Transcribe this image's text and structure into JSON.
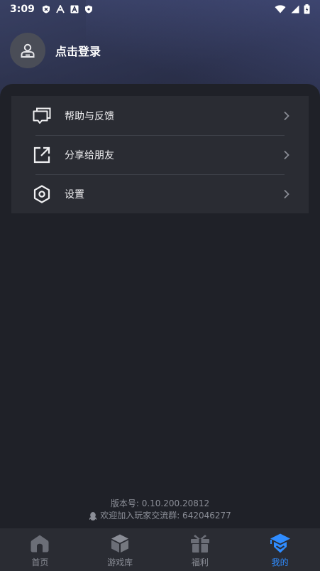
{
  "status_bar": {
    "time": "3:09"
  },
  "profile": {
    "login_text": "点击登录"
  },
  "menu": {
    "items": [
      {
        "label": "帮助与反馈",
        "icon": "feedback-icon"
      },
      {
        "label": "分享给朋友",
        "icon": "share-icon"
      },
      {
        "label": "设置",
        "icon": "settings-icon"
      }
    ]
  },
  "footer": {
    "version": "版本号: 0.10.200.20812",
    "group": "欢迎加入玩家交流群: 642046277"
  },
  "tabs": [
    {
      "label": "首页",
      "icon": "home-icon",
      "active": false
    },
    {
      "label": "游戏库",
      "icon": "game-library-icon",
      "active": false
    },
    {
      "label": "福利",
      "icon": "gift-icon",
      "active": false
    },
    {
      "label": "我的",
      "icon": "profile-icon",
      "active": true
    }
  ],
  "colors": {
    "accent": "#2f8cff",
    "background": "#1f2128",
    "card": "#2a2c33"
  }
}
